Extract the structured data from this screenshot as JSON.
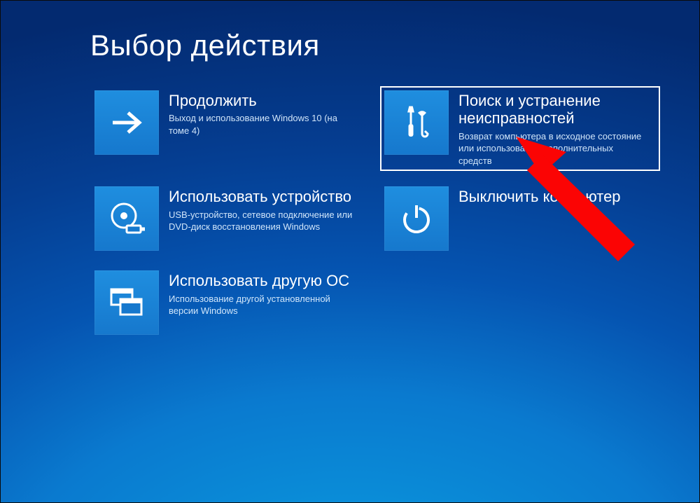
{
  "screen": {
    "title": "Выбор действия"
  },
  "options": {
    "continue": {
      "title": "Продолжить",
      "desc": "Выход и использование Windows 10 (на томе 4)"
    },
    "use_device": {
      "title": "Использовать устройство",
      "desc": "USB-устройство, сетевое подключение или DVD-диск восстановления Windows"
    },
    "other_os": {
      "title": "Использовать другую ОС",
      "desc": "Использование другой установленной версии Windows"
    },
    "troubleshoot": {
      "title": "Поиск и устранение неисправностей",
      "desc": "Возврат компьютера в исходное состояние или использование дополнительных средств"
    },
    "shutdown": {
      "title": "Выключить компьютер",
      "desc": ""
    }
  },
  "annotation": {
    "target": "troubleshoot",
    "color": "#fb0404"
  }
}
